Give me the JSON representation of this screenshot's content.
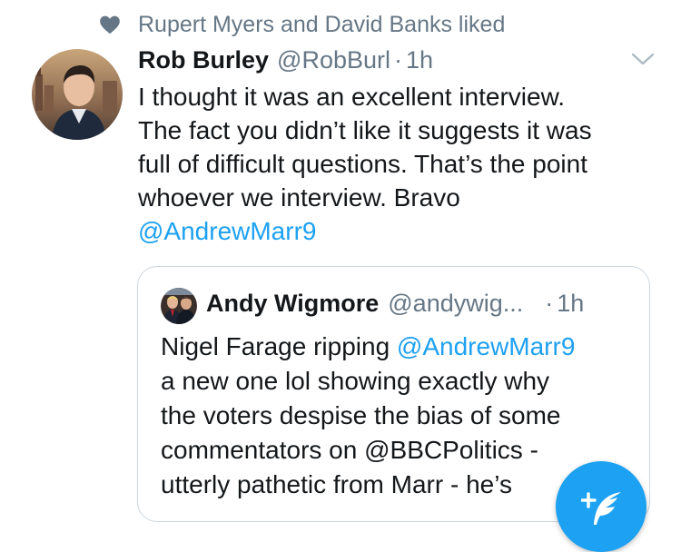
{
  "social_context": {
    "icon": "heart-icon",
    "text": "Rupert Myers and David Banks liked"
  },
  "tweet": {
    "avatar_icon": "profile-photo",
    "author_name": "Rob Burley",
    "author_handle": "@RobBurl",
    "separator": "·",
    "time": "1h",
    "menu_icon": "chevron-down-icon",
    "body_lines": [
      "I thought it was an excellent interview.",
      "The fact you didn’t like it suggests it was",
      "full of difficult questions. That’s the point",
      "whoever we interview. Bravo"
    ],
    "mention": "@AndrewMarr9"
  },
  "quoted_tweet": {
    "avatar_icon": "profile-photo",
    "author_name": "Andy Wigmore",
    "author_handle": "@andywig...",
    "separator": "·",
    "time": "1h",
    "body": {
      "l1_text": "Nigel Farage ripping ",
      "l1_mention": "@AndrewMarr9",
      "l2": "a new one lol showing exactly why",
      "l3": "the voters despise the bias of some",
      "l4_text": "commentators on ",
      "l4_mention": "@BBCPolitics",
      "l4_suffix": " -",
      "l5": "utterly pathetic from Marr - he’s"
    }
  },
  "compose_button": {
    "icon": "compose-feather-icon"
  },
  "colors": {
    "accent": "#1da1f2",
    "secondary_text": "#657786",
    "primary_text": "#14171a",
    "border": "#ccd6dd"
  }
}
